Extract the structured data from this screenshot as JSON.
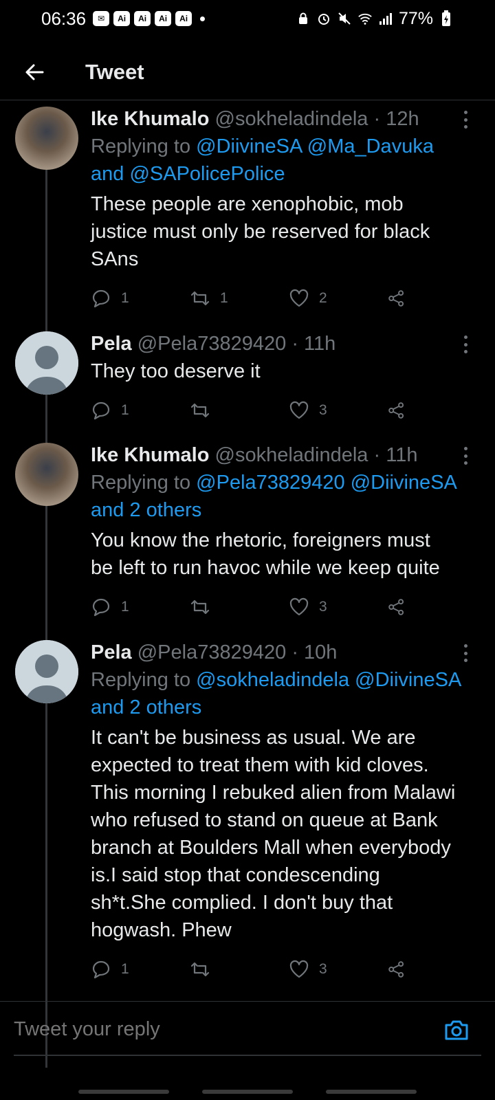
{
  "status_bar": {
    "time": "06:36",
    "badges": [
      "Ai",
      "Ai",
      "Ai",
      "Ai"
    ],
    "battery": "77%"
  },
  "header": {
    "title": "Tweet"
  },
  "tweets": [
    {
      "name": "Ike Khumalo",
      "handle": "@sokheladindela",
      "separator": "·",
      "time": "12h",
      "replying_prefix": "Replying to",
      "replying_line1": "@DiivineSA @Ma_Davuka",
      "replying_line2": "and @SAPolicePolice",
      "text_lines": [
        "These people are xenophobic, mob",
        "justice must only be reserved for black",
        "SAns"
      ],
      "replies": "1",
      "retweets": "1",
      "likes": "2"
    },
    {
      "name": "Pela",
      "handle": "@Pela73829420",
      "separator": "·",
      "time": "11h",
      "text_lines": [
        "They too deserve it"
      ],
      "replies": "1",
      "retweets": "",
      "likes": "3"
    },
    {
      "name": "Ike Khumalo",
      "handle": "@sokheladindela",
      "separator": "·",
      "time": "11h",
      "replying_prefix": "Replying to",
      "replying_line1": "@Pela73829420 @DiivineSA",
      "replying_line2": "and 2 others",
      "text_lines": [
        "You know the rhetoric, foreigners must",
        "be left to run havoc while we keep quite"
      ],
      "replies": "1",
      "retweets": "",
      "likes": "3"
    },
    {
      "name": "Pela",
      "handle": "@Pela73829420",
      "separator": "·",
      "time": "10h",
      "replying_prefix": "Replying to",
      "replying_line1": "@sokheladindela @DiivineSA",
      "replying_line2": "and 2 others",
      "text_lines": [
        "It can't be business as usual. We are",
        "expected to treat them with kid cloves.",
        "This morning I rebuked alien from Malawi",
        "who refused to stand on queue at Bank",
        "branch at Boulders Mall when everybody",
        "is.I said stop that condescending",
        "sh*t.She complied. I don't buy that",
        "hogwash. Phew"
      ],
      "replies": "1",
      "retweets": "",
      "likes": "3"
    }
  ],
  "reply_bar": {
    "placeholder": "Tweet your reply"
  },
  "colors": {
    "background": "#000000",
    "link": "#1d9bf0",
    "muted": "#71767b",
    "text": "#e7e9ea"
  },
  "icons": [
    "back-arrow-icon",
    "more-icon",
    "reply-icon",
    "retweet-icon",
    "like-icon",
    "share-icon",
    "camera-icon"
  ]
}
